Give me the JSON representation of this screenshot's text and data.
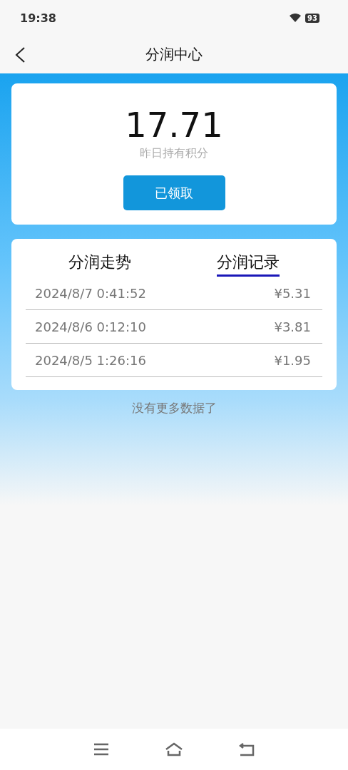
{
  "status_bar": {
    "time": "19:38",
    "battery": "93"
  },
  "header": {
    "title": "分润中心"
  },
  "summary": {
    "value": "17.71",
    "label": "昨日持有积分",
    "button": "已领取"
  },
  "tabs": [
    {
      "label": "分润走势",
      "selected": false
    },
    {
      "label": "分润记录",
      "selected": true
    }
  ],
  "records": [
    {
      "time": "2024/8/7 0:41:52",
      "amount": "¥5.31"
    },
    {
      "time": "2024/8/6 0:12:10",
      "amount": "¥3.81"
    },
    {
      "time": "2024/8/5 1:26:16",
      "amount": "¥1.95"
    }
  ],
  "empty_message": "没有更多数据了"
}
